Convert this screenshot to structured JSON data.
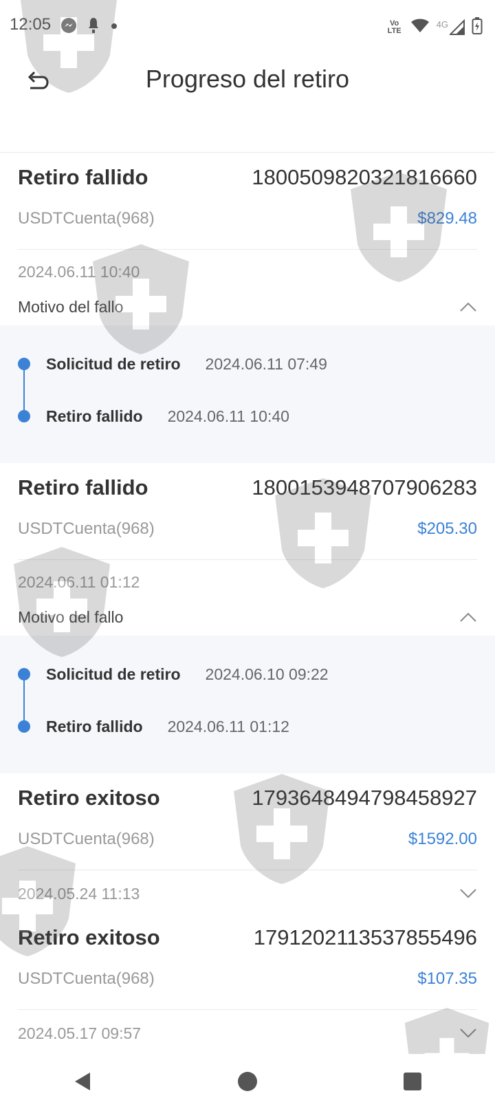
{
  "status_bar": {
    "time": "12:05",
    "left_icons": [
      "messenger-icon",
      "notification-icon",
      "dot-icon"
    ],
    "right_icons": [
      "volte-icon",
      "wifi-icon",
      "signal-4g-icon",
      "battery-icon"
    ],
    "network_label": "4G",
    "volte_label": "Vo LTE"
  },
  "header": {
    "title": "Progreso del retiro",
    "back_icon": "back-arrow-icon"
  },
  "records": [
    {
      "status": "Retiro fallido",
      "id": "1800509820321816660",
      "account": "USDTCuenta(968)",
      "amount": "$829.48",
      "date": "2024.06.11 10:40",
      "reason_label": "Motivo del fallo",
      "expanded": true,
      "timeline": [
        {
          "label": "Solicitud de retiro",
          "date": "2024.06.11 07:49"
        },
        {
          "label": "Retiro fallido",
          "date": "2024.06.11 10:40"
        }
      ]
    },
    {
      "status": "Retiro fallido",
      "id": "1800153948707906283",
      "account": "USDTCuenta(968)",
      "amount": "$205.30",
      "date": "2024.06.11 01:12",
      "reason_label": "Motivo del fallo",
      "expanded": true,
      "timeline": [
        {
          "label": "Solicitud de retiro",
          "date": "2024.06.10 09:22"
        },
        {
          "label": "Retiro fallido",
          "date": "2024.06.11 01:12"
        }
      ]
    },
    {
      "status": "Retiro exitoso",
      "id": "1793648494798458927",
      "account": "USDTCuenta(968)",
      "amount": "$1592.00",
      "date": "2024.05.24 11:13",
      "expanded": false
    },
    {
      "status": "Retiro exitoso",
      "id": "1791202113537855496",
      "account": "USDTCuenta(968)",
      "amount": "$107.35",
      "date": "2024.05.17 09:57",
      "expanded": false
    }
  ],
  "nav": {
    "back": "nav-back-icon",
    "home": "nav-home-icon",
    "recents": "nav-recents-icon"
  },
  "colors": {
    "accent": "#3b82d6",
    "timeline_bg": "#f5f7fb",
    "muted_text": "#999999"
  }
}
